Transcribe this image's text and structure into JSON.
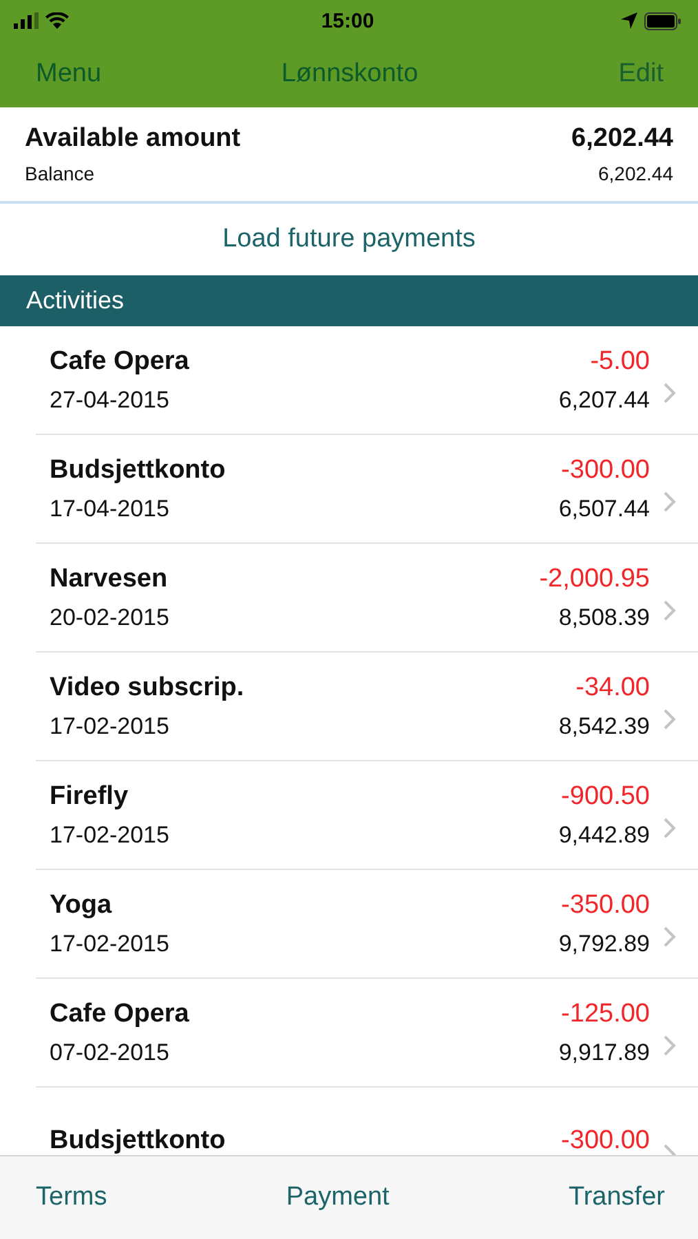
{
  "status_bar": {
    "time": "15:00"
  },
  "nav_bar": {
    "left": "Menu",
    "title": "Lønnskonto",
    "right": "Edit"
  },
  "summary": {
    "label": "Available amount",
    "amount": "6,202.44",
    "sub_label": "Balance",
    "sub_amount": "6,202.44"
  },
  "load_button": "Load future payments",
  "section_header": "Activities",
  "activities": [
    {
      "name": "Cafe Opera",
      "date": "27-04-2015",
      "amount": "-5.00",
      "balance": "6,207.44"
    },
    {
      "name": "Budsjettkonto",
      "date": "17-04-2015",
      "amount": "-300.00",
      "balance": "6,507.44"
    },
    {
      "name": "Narvesen",
      "date": "20-02-2015",
      "amount": "-2,000.95",
      "balance": "8,508.39"
    },
    {
      "name": "Video subscrip.",
      "date": "17-02-2015",
      "amount": "-34.00",
      "balance": "8,542.39"
    },
    {
      "name": "Firefly",
      "date": "17-02-2015",
      "amount": "-900.50",
      "balance": "9,442.89"
    },
    {
      "name": "Yoga",
      "date": "17-02-2015",
      "amount": "-350.00",
      "balance": "9,792.89"
    },
    {
      "name": "Cafe Opera",
      "date": "07-02-2015",
      "amount": "-125.00",
      "balance": "9,917.89"
    },
    {
      "name": "Budsjettkonto",
      "amount": "-300.00"
    }
  ],
  "tab_bar": [
    "Terms",
    "Payment",
    "Transfer"
  ]
}
